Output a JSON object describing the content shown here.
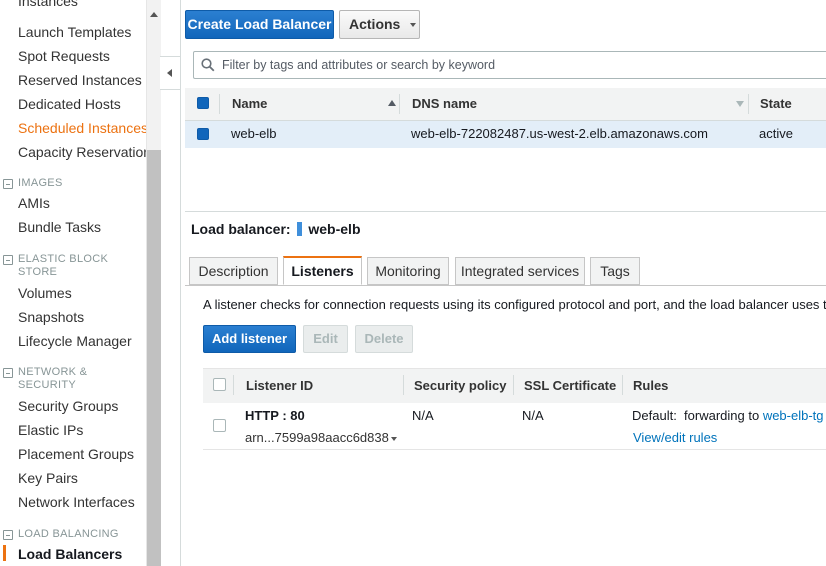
{
  "sidebar": {
    "items_top": [
      {
        "label": "Instances"
      },
      {
        "label": "Launch Templates"
      },
      {
        "label": "Spot Requests"
      },
      {
        "label": "Reserved Instances"
      },
      {
        "label": "Dedicated Hosts"
      },
      {
        "label": "Scheduled Instances"
      },
      {
        "label": "Capacity Reservations"
      }
    ],
    "sections": {
      "images": {
        "title": "IMAGES",
        "items": [
          "AMIs",
          "Bundle Tasks"
        ]
      },
      "ebs": {
        "title_line1": "ELASTIC BLOCK",
        "title_line2": "STORE",
        "items": [
          "Volumes",
          "Snapshots",
          "Lifecycle Manager"
        ]
      },
      "network": {
        "title_line1": "NETWORK &",
        "title_line2": "SECURITY",
        "items": [
          "Security Groups",
          "Elastic IPs",
          "Placement Groups",
          "Key Pairs",
          "Network Interfaces"
        ]
      },
      "lb": {
        "title": "LOAD BALANCING",
        "items": [
          "Load Balancers"
        ]
      }
    }
  },
  "toolbar": {
    "create_label": "Create Load Balancer",
    "actions_label": "Actions"
  },
  "search": {
    "placeholder": "Filter by tags and attributes or search by keyword"
  },
  "table": {
    "columns": [
      "Name",
      "DNS name",
      "State"
    ],
    "rows": [
      {
        "name": "web-elb",
        "dns": "web-elb-722082487.us-west-2.elb.amazonaws.com",
        "state": "active"
      }
    ]
  },
  "details": {
    "label": "Load balancer:",
    "name": "web-elb",
    "tabs": [
      "Description",
      "Listeners",
      "Monitoring",
      "Integrated services",
      "Tags"
    ],
    "active_tab": "Listeners",
    "description": "A listener checks for connection requests using its configured protocol and port, and the load balancer uses the",
    "buttons": {
      "add": "Add listener",
      "edit": "Edit",
      "delete": "Delete"
    },
    "listener_columns": [
      "Listener ID",
      "Security policy",
      "SSL Certificate",
      "Rules"
    ],
    "listener_row": {
      "id": "HTTP : 80",
      "arn": "arn...7599a98aacc6d838",
      "security_policy": "N/A",
      "ssl_certificate": "N/A",
      "rules_prefix": "Default:  forwarding to",
      "rules_target": "web-elb-tg",
      "view_edit": "View/edit rules"
    }
  },
  "colors": {
    "primary_button": "#1166bb",
    "active_nav": "#ec7211",
    "link": "#0073bb",
    "selected_row": "#e3eef8"
  }
}
